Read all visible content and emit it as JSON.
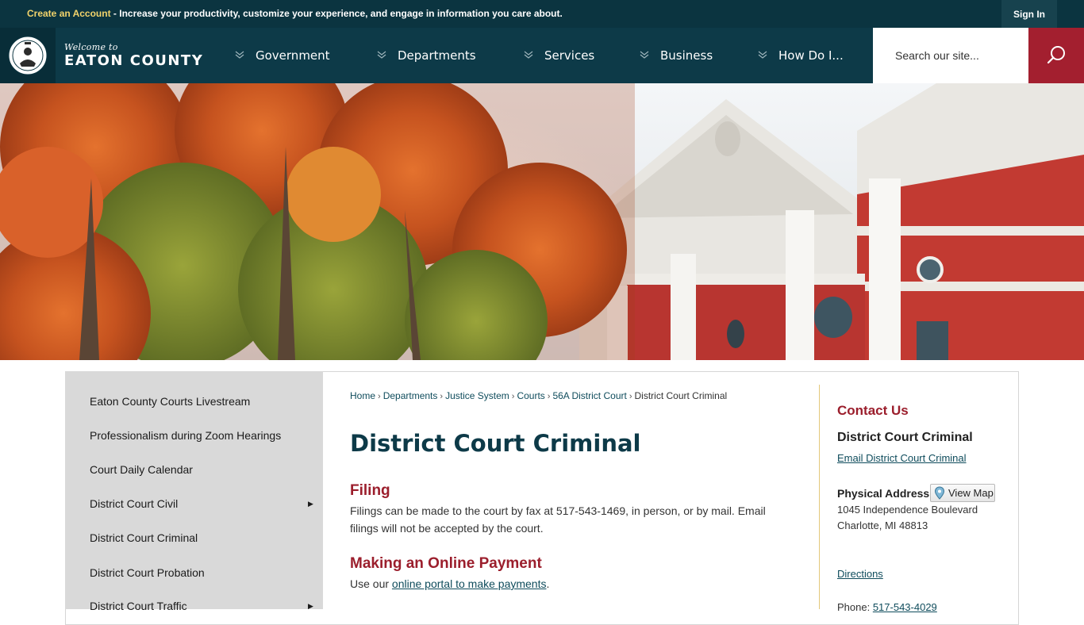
{
  "topbar": {
    "create_account": "Create an Account",
    "promo_text": " - Increase your productivity, customize your experience, and engage in information you care about.",
    "sign_in": "Sign In"
  },
  "logo": {
    "welcome": "Welcome to",
    "county": "EATON COUNTY"
  },
  "nav": {
    "items": [
      {
        "label": "Government"
      },
      {
        "label": "Departments"
      },
      {
        "label": "Services"
      },
      {
        "label": "Business"
      },
      {
        "label": "How Do I..."
      }
    ]
  },
  "search": {
    "placeholder": "Search our site...",
    "icon": "search-icon"
  },
  "hero": {
    "alt_icon": "courthouse-photo"
  },
  "sidebar": {
    "items": [
      {
        "label": "Eaton County Courts Livestream"
      },
      {
        "label": "Professionalism during Zoom Hearings"
      },
      {
        "label": "Court Daily Calendar"
      },
      {
        "label": "District Court Civil",
        "arrow": "▶"
      },
      {
        "label": "District Court Criminal"
      },
      {
        "label": "District Court Probation"
      },
      {
        "label": "District Court Traffic",
        "arrow": "▶"
      }
    ]
  },
  "breadcrumb": {
    "items": [
      "Home",
      "Departments",
      "Justice System",
      "Courts",
      "56A District Court"
    ],
    "current": "District Court Criminal",
    "separator": "›"
  },
  "main": {
    "title": "District Court Criminal",
    "sections": [
      {
        "heading": "Filing",
        "body": "Filings can be made to the court by fax at 517-543-1469, in person, or by mail. Email filings will not be accepted by the court."
      },
      {
        "heading": "Making an Online Payment",
        "body_prefix": "Use our ",
        "link": "online portal to make payments",
        "body_suffix": "."
      }
    ]
  },
  "contact": {
    "heading": "Contact Us",
    "name": "District Court Criminal",
    "email_link": "Email District Court Criminal",
    "address_label": "Physical Address",
    "view_map": "View Map",
    "address_line1": "1045 Independence Boulevard",
    "address_line2": "Charlotte, MI 48813",
    "directions": "Directions",
    "phone_label": "Phone: ",
    "phone": "517-543-4029"
  },
  "colors": {
    "nav_bg": "#0d3a48",
    "accent_red": "#a31f2f",
    "heading_red": "#9b1e2c",
    "promo_yellow": "#f2d36b"
  }
}
